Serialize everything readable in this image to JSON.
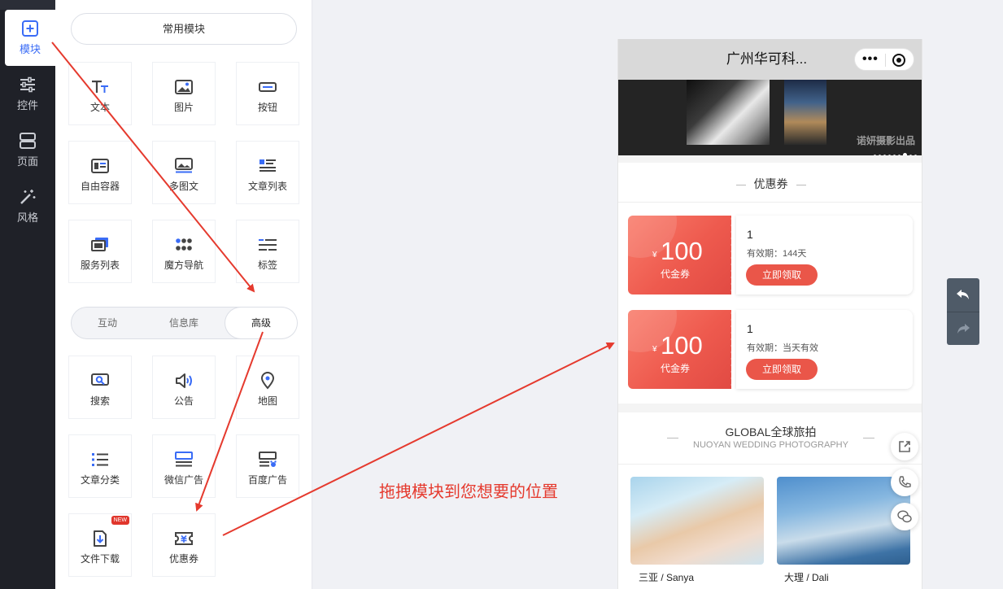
{
  "sidebar": {
    "items": [
      {
        "label": "模块",
        "icon": "plus-square-icon",
        "active": true
      },
      {
        "label": "控件",
        "icon": "sliders-icon",
        "active": false
      },
      {
        "label": "页面",
        "icon": "pages-icon",
        "active": false
      },
      {
        "label": "风格",
        "icon": "magic-wand-icon",
        "active": false
      }
    ]
  },
  "panel": {
    "common_button": "常用模块",
    "common_modules": [
      {
        "label": "文本",
        "icon": "text-icon"
      },
      {
        "label": "图片",
        "icon": "image-icon"
      },
      {
        "label": "按钮",
        "icon": "button-icon"
      },
      {
        "label": "自由容器",
        "icon": "container-icon"
      },
      {
        "label": "多图文",
        "icon": "multi-image-icon"
      },
      {
        "label": "文章列表",
        "icon": "article-list-icon"
      },
      {
        "label": "服务列表",
        "icon": "service-list-icon"
      },
      {
        "label": "魔方导航",
        "icon": "grid-nav-icon"
      },
      {
        "label": "标签",
        "icon": "tag-icon"
      }
    ],
    "tabs": [
      {
        "label": "互动",
        "active": false
      },
      {
        "label": "信息库",
        "active": false
      },
      {
        "label": "高级",
        "active": true
      }
    ],
    "advanced_modules": [
      {
        "label": "搜索",
        "icon": "search-icon"
      },
      {
        "label": "公告",
        "icon": "announcement-icon"
      },
      {
        "label": "地图",
        "icon": "map-pin-icon"
      },
      {
        "label": "文章分类",
        "icon": "article-category-icon"
      },
      {
        "label": "微信广告",
        "icon": "wechat-ad-icon"
      },
      {
        "label": "百度广告",
        "icon": "baidu-ad-icon"
      },
      {
        "label": "文件下载",
        "icon": "file-download-icon",
        "badge": "NEW"
      },
      {
        "label": "优惠券",
        "icon": "coupon-icon"
      }
    ]
  },
  "preview": {
    "title": "广州华可科...",
    "capsule_more": "•••",
    "banner_watermark": "诺妍摄影出品",
    "coupon_section_title": "优惠券",
    "coupons": [
      {
        "currency": "¥",
        "amount": "100",
        "type": "代金券",
        "name": "1",
        "validity": "有效期：144天",
        "button": "立即领取"
      },
      {
        "currency": "¥",
        "amount": "100",
        "type": "代金券",
        "name": "1",
        "validity": "有效期：当天有效",
        "button": "立即领取"
      }
    ],
    "gallery_title": "GLOBAL全球旅拍",
    "gallery_subtitle": "NUOYAN WEDDING PHOTOGRAPHY",
    "gallery": [
      {
        "caption": "三亚 / Sanya"
      },
      {
        "caption": "大理 / Dali"
      }
    ]
  },
  "annotation": {
    "text": "拖拽模块到您想要的位置",
    "color": "#e53a2e"
  },
  "colors": {
    "accent": "#3a6cf6",
    "coupon": "#ea5649",
    "rail": "#1f2128"
  }
}
